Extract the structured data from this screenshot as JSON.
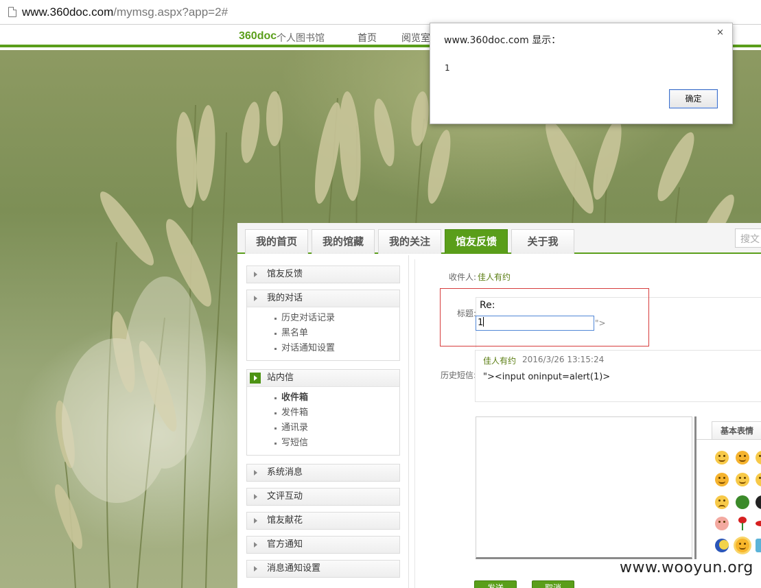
{
  "browser": {
    "url_host": "www.360doc.com",
    "url_path": "/mymsg.aspx?app=2#"
  },
  "site": {
    "logo": "360doc",
    "logo_sub": "个人图书馆",
    "nav": [
      "首页",
      "阅览室"
    ]
  },
  "alert": {
    "title": "www.360doc.com 显示：",
    "close": "×",
    "message": "1",
    "ok_label": "确定"
  },
  "tabs": [
    {
      "label": "我的首页",
      "active": false
    },
    {
      "label": "我的馆藏",
      "active": false
    },
    {
      "label": "我的关注",
      "active": false
    },
    {
      "label": "馆友反馈",
      "active": true
    },
    {
      "label": "关于我",
      "active": false
    }
  ],
  "search": {
    "placeholder": "搜文"
  },
  "sidebar": {
    "groups": [
      {
        "label": "馆友反馈",
        "items": []
      },
      {
        "label": "我的对话",
        "items": [
          "历史对话记录",
          "黑名单",
          "对话通知设置"
        ]
      },
      {
        "label": "站内信",
        "items": [
          "收件箱",
          "发件箱",
          "通讯录",
          "写短信"
        ],
        "active": true
      },
      {
        "label": "系统消息",
        "items": []
      },
      {
        "label": "文评互动",
        "items": []
      },
      {
        "label": "馆友献花",
        "items": []
      },
      {
        "label": "官方通知",
        "items": []
      },
      {
        "label": "消息通知设置",
        "items": []
      }
    ]
  },
  "form": {
    "recipient_label": "收件人:",
    "recipient": "佳人有约",
    "title_label": "标题:",
    "title_prefix": "Re:",
    "title_value": "1",
    "after_quote": "\">",
    "history_label": "历史短信:",
    "history": {
      "author": "佳人有约",
      "time": "2016/3/26 13:15:24",
      "message": "\"><input oninput=alert(1)>"
    }
  },
  "emoticons": {
    "tab_label": "基本表情",
    "icons": [
      "smile-emoji",
      "dizzy-emoji",
      "cry-emoji",
      "laugh-emoji",
      "think-emoji",
      "sweat-emoji",
      "sad-emoji",
      "turtle-emoji",
      "panda-emoji",
      "pig-emoji",
      "rose-emoji",
      "lips-emoji",
      "moon-emoji",
      "sun-emoji",
      "gift-emoji"
    ]
  },
  "buttons": {
    "send": "发送",
    "cancel": "取消"
  },
  "watermark": "www.wooyun.org",
  "colors": {
    "brand_green": "#5a9e1a",
    "alert_border": "#d63b3b",
    "input_focus": "#4f86d6"
  }
}
